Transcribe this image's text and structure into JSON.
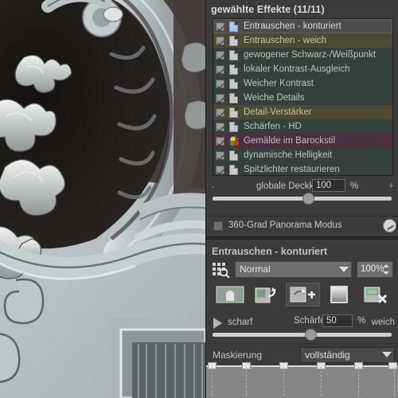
{
  "photo": {
    "alt_description": "Nahaufnahme eines barocken Stuck-Ornaments mit Wappen und Löwe an einer Hausfassade"
  },
  "effects_panel": {
    "title": "gewählte Effekte (11/11)",
    "items": [
      {
        "label": "Entrauschen - konturiert",
        "checked": true,
        "icon": "layer-icon-blue",
        "state": "selected"
      },
      {
        "label": "Entrauschen - weich",
        "checked": true,
        "icon": "layer-icon",
        "state": "olive"
      },
      {
        "label": "gewogener Schwarz-/Weißpunkt",
        "checked": true,
        "icon": "layer-icon",
        "state": "normal"
      },
      {
        "label": "lokaler Kontrast-Ausgleich",
        "checked": true,
        "icon": "layer-icon",
        "state": "normal"
      },
      {
        "label": "Weicher Kontrast",
        "checked": true,
        "icon": "layer-icon",
        "state": "normal"
      },
      {
        "label": "Weiche Details",
        "checked": true,
        "icon": "layer-icon",
        "state": "normal"
      },
      {
        "label": "Detail-Verstärker",
        "checked": true,
        "icon": "layer-icon",
        "state": "olive"
      },
      {
        "label": "Schärfen - HD",
        "checked": true,
        "icon": "layer-icon",
        "state": "normal"
      },
      {
        "label": "Gemälde im Barockstil",
        "checked": true,
        "icon": "palette-icon",
        "state": "purple"
      },
      {
        "label": "dynamische Helligkeit",
        "checked": true,
        "icon": "layer-icon",
        "state": "normal"
      },
      {
        "label": "Spitzlichter restaurieren",
        "checked": true,
        "icon": "layer-icon",
        "state": "normal"
      }
    ],
    "opacity": {
      "label": "globale Deckkraft",
      "value": "100",
      "unit": "%",
      "minus": "-",
      "plus": "+",
      "slider_percent": 53
    },
    "panorama": {
      "label": "360-Grad Panorama Modus",
      "checked": false,
      "dial_name": "rotation-dial"
    }
  },
  "effect_detail": {
    "title": "Entrauschen - konturiert",
    "blend": {
      "mode_icon": "mask-grid-icon",
      "mode": "Normal",
      "opacity": "100%"
    },
    "tools": [
      {
        "name": "apply-to-whole-image-button",
        "active": false
      },
      {
        "name": "mask-transfer-button",
        "active": false
      },
      {
        "name": "add-mask-button",
        "active": true
      },
      {
        "name": "gradient-mask-button",
        "active": false
      },
      {
        "name": "delete-mask-button",
        "active": false
      }
    ],
    "sharpness": {
      "expand_icon": "play-triangle-icon",
      "left_label": "scharf",
      "name": "Schärfe",
      "value": "50",
      "unit": "%",
      "right_label": "weich",
      "slider_percent": 54
    },
    "mask": {
      "label": "Maskierung",
      "value": "vollständig"
    }
  },
  "colors": {
    "panel_bg": "#3b3b3b",
    "list_bg": "#33403c",
    "selected_row": "#4d4d4d",
    "purple_row": "#4a2f3e",
    "olive_row": "#4d4a32",
    "text": "#b9c6bd",
    "title_text": "#d9d9d9",
    "slider_track": "#cfcfcf",
    "mask_strip": "#868686"
  }
}
